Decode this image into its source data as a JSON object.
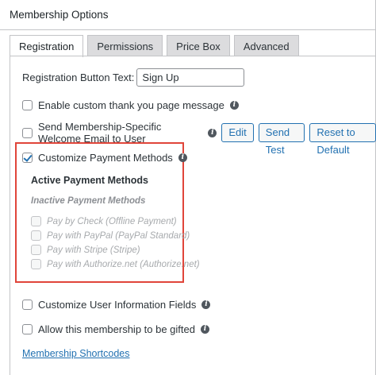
{
  "header": {
    "title": "Membership Options"
  },
  "tabs": [
    {
      "label": "Registration"
    },
    {
      "label": "Permissions"
    },
    {
      "label": "Price Box"
    },
    {
      "label": "Advanced"
    }
  ],
  "registration": {
    "button_text_label": "Registration Button Text:",
    "button_text_value": "Sign Up",
    "thank_you_label": "Enable custom thank you page message",
    "welcome_email_label": "Send Membership-Specific Welcome Email to User",
    "edit_label": "Edit",
    "send_test_label": "Send Test",
    "reset_label": "Reset to Default",
    "customize_payment_label": "Customize Payment Methods",
    "active_methods_heading": "Active Payment Methods",
    "inactive_methods_heading": "Inactive Payment Methods",
    "inactive_methods": [
      {
        "label": "Pay by Check (Offline Payment)"
      },
      {
        "label": "Pay with PayPal (PayPal Standard)"
      },
      {
        "label": "Pay with Stripe (Stripe)"
      },
      {
        "label": "Pay with Authorize.net (Authorize.net)"
      }
    ],
    "customize_user_info_label": "Customize User Information Fields",
    "gifted_label": "Allow this membership to be gifted",
    "shortcodes_link": "Membership Shortcodes"
  },
  "colors": {
    "accent": "#2271b1",
    "highlight_border": "#e0453a"
  }
}
